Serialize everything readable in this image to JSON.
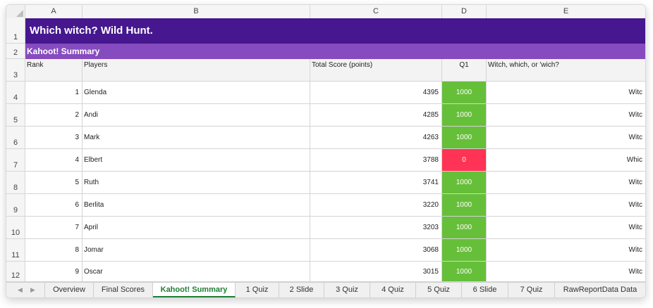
{
  "columns": [
    "A",
    "B",
    "C",
    "D",
    "E"
  ],
  "rows": [
    "1",
    "2",
    "3",
    "4",
    "5",
    "6",
    "7",
    "8",
    "9",
    "10",
    "11",
    "12"
  ],
  "title": "Which witch? Wild Hunt.",
  "subtitle": "Kahoot! Summary",
  "headers": {
    "rank": "Rank",
    "players": "Players",
    "total_score": "Total Score (points)",
    "q1": "Q1",
    "question": "Witch, which, or 'wich?"
  },
  "players": [
    {
      "rank": "1",
      "name": "Glenda",
      "score": "4395",
      "q1": "1000",
      "q1_correct": true,
      "answer": "Witc"
    },
    {
      "rank": "2",
      "name": "Andi",
      "score": "4285",
      "q1": "1000",
      "q1_correct": true,
      "answer": "Witc"
    },
    {
      "rank": "3",
      "name": "Mark",
      "score": "4263",
      "q1": "1000",
      "q1_correct": true,
      "answer": "Witc"
    },
    {
      "rank": "4",
      "name": "Elbert",
      "score": "3788",
      "q1": "0",
      "q1_correct": false,
      "answer": "Whic"
    },
    {
      "rank": "5",
      "name": "Ruth",
      "score": "3741",
      "q1": "1000",
      "q1_correct": true,
      "answer": "Witc"
    },
    {
      "rank": "6",
      "name": "Berlita",
      "score": "3220",
      "q1": "1000",
      "q1_correct": true,
      "answer": "Witc"
    },
    {
      "rank": "7",
      "name": "April",
      "score": "3203",
      "q1": "1000",
      "q1_correct": true,
      "answer": "Witc"
    },
    {
      "rank": "8",
      "name": "Jomar",
      "score": "3068",
      "q1": "1000",
      "q1_correct": true,
      "answer": "Witc"
    },
    {
      "rank": "9",
      "name": "Oscar",
      "score": "3015",
      "q1": "1000",
      "q1_correct": true,
      "answer": "Witc"
    }
  ],
  "tabs": [
    "Overview",
    "Final Scores",
    "Kahoot! Summary",
    "1 Quiz",
    "2 Slide",
    "3 Quiz",
    "4 Quiz",
    "5 Quiz",
    "6 Slide",
    "7 Quiz",
    "RawReportData Data"
  ],
  "active_tab": "Kahoot! Summary",
  "colors": {
    "title_band": "#46178f",
    "subtitle_band": "#864cbf",
    "correct": "#66bf39",
    "incorrect": "#ff3355",
    "active_tab_text": "#1e7e34"
  },
  "icons": {
    "prev_sheet": "triangle-left-icon",
    "next_sheet": "triangle-right-icon",
    "select_all": "corner-triangle-icon"
  }
}
